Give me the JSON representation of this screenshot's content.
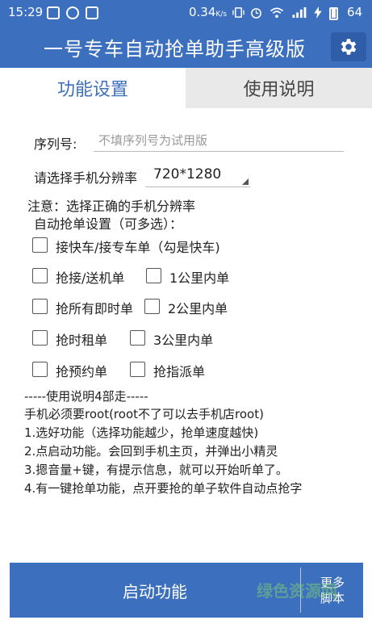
{
  "status_bar": {
    "time": "15:29",
    "net_speed": "0.34",
    "net_speed_unit": "K/s",
    "battery_percent": "64"
  },
  "title_bar": {
    "title": "一号专车自动抢单助手高级版",
    "settings_icon": "gear-icon"
  },
  "tabs": [
    {
      "label": "功能设置",
      "active": true
    },
    {
      "label": "使用说明",
      "active": false
    }
  ],
  "serial": {
    "label": "序列号:",
    "value": "",
    "placeholder": "不填序列号为试用版"
  },
  "resolution": {
    "label": "请选择手机分辨率",
    "selected": "720*1280"
  },
  "notice": "注意：选择正确的手机分辨率",
  "auto_grab_title": "自动抢单设置（可多选）：",
  "options": [
    {
      "label": "接快车/接专车单（勾是快车)",
      "checked": false
    },
    {
      "label": "抢接/送机单",
      "checked": false
    },
    {
      "label": "1公里内单",
      "checked": false
    },
    {
      "label": "抢所有即时单",
      "checked": false
    },
    {
      "label": "2公里内单",
      "checked": false
    },
    {
      "label": "抢时租单",
      "checked": false
    },
    {
      "label": "3公里内单",
      "checked": false
    },
    {
      "label": "抢预约单",
      "checked": false
    },
    {
      "label": "抢指派单",
      "checked": false
    }
  ],
  "instructions": [
    "-----使用说明4部走-----",
    "手机必须要root(root不了可以去手机店root)",
    "1.选好功能（选择功能越少，抢单速度越快)",
    "2.点启动功能。会回到手机主页，并弹出小精灵",
    "3.摁音量+键，有提示信息，就可以开始听单了。",
    "4.有一键抢单功能，点开要抢的单子软件自动点抢字"
  ],
  "bottom_bar": {
    "start_label": "启动功能",
    "more_line1": "更多",
    "more_line2": "脚本"
  },
  "watermark": "绿色资源网",
  "colors": {
    "primary": "#3c6fbd",
    "tab_inactive_bg": "#e9e9e9"
  }
}
